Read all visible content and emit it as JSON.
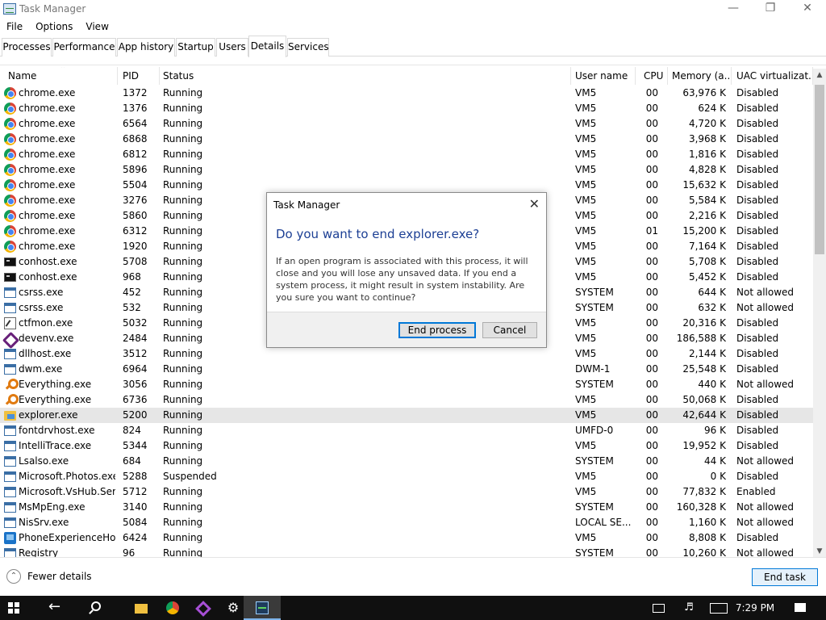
{
  "window": {
    "title": "Task Manager"
  },
  "menu": [
    "File",
    "Options",
    "View"
  ],
  "tabs": [
    "Processes",
    "Performance",
    "App history",
    "Startup",
    "Users",
    "Details",
    "Services"
  ],
  "active_tab": "Details",
  "columns": {
    "name": "Name",
    "pid": "PID",
    "status": "Status",
    "user": "User name",
    "cpu": "CPU",
    "memory": "Memory (a...",
    "uac": "UAC virtualizat..."
  },
  "rows": [
    {
      "icon": "chrome-icon",
      "name": "chrome.exe",
      "pid": "1372",
      "status": "Running",
      "user": "VM5",
      "cpu": "00",
      "memory": "63,976 K",
      "uac": "Disabled"
    },
    {
      "icon": "chrome-icon",
      "name": "chrome.exe",
      "pid": "1376",
      "status": "Running",
      "user": "VM5",
      "cpu": "00",
      "memory": "624 K",
      "uac": "Disabled"
    },
    {
      "icon": "chrome-icon",
      "name": "chrome.exe",
      "pid": "6564",
      "status": "Running",
      "user": "VM5",
      "cpu": "00",
      "memory": "4,720 K",
      "uac": "Disabled"
    },
    {
      "icon": "chrome-icon",
      "name": "chrome.exe",
      "pid": "6868",
      "status": "Running",
      "user": "VM5",
      "cpu": "00",
      "memory": "3,968 K",
      "uac": "Disabled"
    },
    {
      "icon": "chrome-icon",
      "name": "chrome.exe",
      "pid": "6812",
      "status": "Running",
      "user": "VM5",
      "cpu": "00",
      "memory": "1,816 K",
      "uac": "Disabled"
    },
    {
      "icon": "chrome-icon",
      "name": "chrome.exe",
      "pid": "5896",
      "status": "Running",
      "user": "VM5",
      "cpu": "00",
      "memory": "4,828 K",
      "uac": "Disabled"
    },
    {
      "icon": "chrome-icon",
      "name": "chrome.exe",
      "pid": "5504",
      "status": "Running",
      "user": "VM5",
      "cpu": "00",
      "memory": "15,632 K",
      "uac": "Disabled"
    },
    {
      "icon": "chrome-icon",
      "name": "chrome.exe",
      "pid": "3276",
      "status": "Running",
      "user": "VM5",
      "cpu": "00",
      "memory": "5,584 K",
      "uac": "Disabled"
    },
    {
      "icon": "chrome-icon",
      "name": "chrome.exe",
      "pid": "5860",
      "status": "Running",
      "user": "VM5",
      "cpu": "00",
      "memory": "2,216 K",
      "uac": "Disabled"
    },
    {
      "icon": "chrome-icon",
      "name": "chrome.exe",
      "pid": "6312",
      "status": "Running",
      "user": "VM5",
      "cpu": "01",
      "memory": "15,200 K",
      "uac": "Disabled"
    },
    {
      "icon": "chrome-icon",
      "name": "chrome.exe",
      "pid": "1920",
      "status": "Running",
      "user": "VM5",
      "cpu": "00",
      "memory": "7,164 K",
      "uac": "Disabled"
    },
    {
      "icon": "console-icon",
      "name": "conhost.exe",
      "pid": "5708",
      "status": "Running",
      "user": "VM5",
      "cpu": "00",
      "memory": "5,708 K",
      "uac": "Disabled"
    },
    {
      "icon": "console-icon",
      "name": "conhost.exe",
      "pid": "968",
      "status": "Running",
      "user": "VM5",
      "cpu": "00",
      "memory": "5,452 K",
      "uac": "Disabled"
    },
    {
      "icon": "window-icon",
      "name": "csrss.exe",
      "pid": "452",
      "status": "Running",
      "user": "SYSTEM",
      "cpu": "00",
      "memory": "644 K",
      "uac": "Not allowed"
    },
    {
      "icon": "window-icon",
      "name": "csrss.exe",
      "pid": "532",
      "status": "Running",
      "user": "SYSTEM",
      "cpu": "00",
      "memory": "632 K",
      "uac": "Not allowed"
    },
    {
      "icon": "ctfmon-icon",
      "name": "ctfmon.exe",
      "pid": "5032",
      "status": "Running",
      "user": "VM5",
      "cpu": "00",
      "memory": "20,316 K",
      "uac": "Disabled"
    },
    {
      "icon": "visual-studio-icon",
      "name": "devenv.exe",
      "pid": "2484",
      "status": "Running",
      "user": "VM5",
      "cpu": "00",
      "memory": "186,588 K",
      "uac": "Disabled"
    },
    {
      "icon": "window-icon",
      "name": "dllhost.exe",
      "pid": "3512",
      "status": "Running",
      "user": "VM5",
      "cpu": "00",
      "memory": "2,144 K",
      "uac": "Disabled"
    },
    {
      "icon": "window-icon",
      "name": "dwm.exe",
      "pid": "6964",
      "status": "Running",
      "user": "DWM-1",
      "cpu": "00",
      "memory": "25,548 K",
      "uac": "Disabled"
    },
    {
      "icon": "everything-search-icon",
      "name": "Everything.exe",
      "pid": "3056",
      "status": "Running",
      "user": "SYSTEM",
      "cpu": "00",
      "memory": "440 K",
      "uac": "Not allowed"
    },
    {
      "icon": "everything-search-icon",
      "name": "Everything.exe",
      "pid": "6736",
      "status": "Running",
      "user": "VM5",
      "cpu": "00",
      "memory": "50,068 K",
      "uac": "Disabled"
    },
    {
      "icon": "explorer-folder-icon",
      "name": "explorer.exe",
      "pid": "5200",
      "status": "Running",
      "user": "VM5",
      "cpu": "00",
      "memory": "42,644 K",
      "uac": "Disabled",
      "selected": true
    },
    {
      "icon": "window-icon",
      "name": "fontdrvhost.exe",
      "pid": "824",
      "status": "Running",
      "user": "UMFD-0",
      "cpu": "00",
      "memory": "96 K",
      "uac": "Disabled"
    },
    {
      "icon": "window-icon",
      "name": "IntelliTrace.exe",
      "pid": "5344",
      "status": "Running",
      "user": "VM5",
      "cpu": "00",
      "memory": "19,952 K",
      "uac": "Disabled"
    },
    {
      "icon": "window-icon",
      "name": "Lsalso.exe",
      "pid": "684",
      "status": "Running",
      "user": "SYSTEM",
      "cpu": "00",
      "memory": "44 K",
      "uac": "Not allowed"
    },
    {
      "icon": "window-icon",
      "name": "Microsoft.Photos.exe",
      "pid": "5288",
      "status": "Suspended",
      "user": "VM5",
      "cpu": "00",
      "memory": "0 K",
      "uac": "Disabled"
    },
    {
      "icon": "window-icon",
      "name": "Microsoft.VsHub.Ser...",
      "pid": "5712",
      "status": "Running",
      "user": "VM5",
      "cpu": "00",
      "memory": "77,832 K",
      "uac": "Enabled"
    },
    {
      "icon": "window-icon",
      "name": "MsMpEng.exe",
      "pid": "3140",
      "status": "Running",
      "user": "SYSTEM",
      "cpu": "00",
      "memory": "160,328 K",
      "uac": "Not allowed"
    },
    {
      "icon": "window-icon",
      "name": "NisSrv.exe",
      "pid": "5084",
      "status": "Running",
      "user": "LOCAL SE...",
      "cpu": "00",
      "memory": "1,160 K",
      "uac": "Not allowed"
    },
    {
      "icon": "phone-icon",
      "name": "PhoneExperienceHo...",
      "pid": "6424",
      "status": "Running",
      "user": "VM5",
      "cpu": "00",
      "memory": "8,808 K",
      "uac": "Disabled"
    },
    {
      "icon": "window-icon",
      "name": "Registry",
      "pid": "96",
      "status": "Running",
      "user": "SYSTEM",
      "cpu": "00",
      "memory": "10,260 K",
      "uac": "Not allowed"
    }
  ],
  "footer": {
    "fewer_details": "Fewer details",
    "end_task": "End task"
  },
  "dialog": {
    "title": "Task Manager",
    "heading": "Do you want to end explorer.exe?",
    "body": "If an open program is associated with this process, it will close and you will lose any unsaved data. If you end a system process, it might result in system instability. Are you sure you want to continue?",
    "end_button": "End process",
    "cancel_button": "Cancel"
  },
  "taskbar": {
    "clock": "7:29 PM",
    "pinned": [
      "file-explorer-icon",
      "chrome-icon",
      "visual-studio-icon",
      "settings-gear-icon",
      "task-manager-icon"
    ]
  },
  "colors": {
    "dialog_heading": "#1c3f94",
    "selected_row": "#e6e6e6",
    "accent": "#0078d7",
    "taskbar": "#101010"
  }
}
